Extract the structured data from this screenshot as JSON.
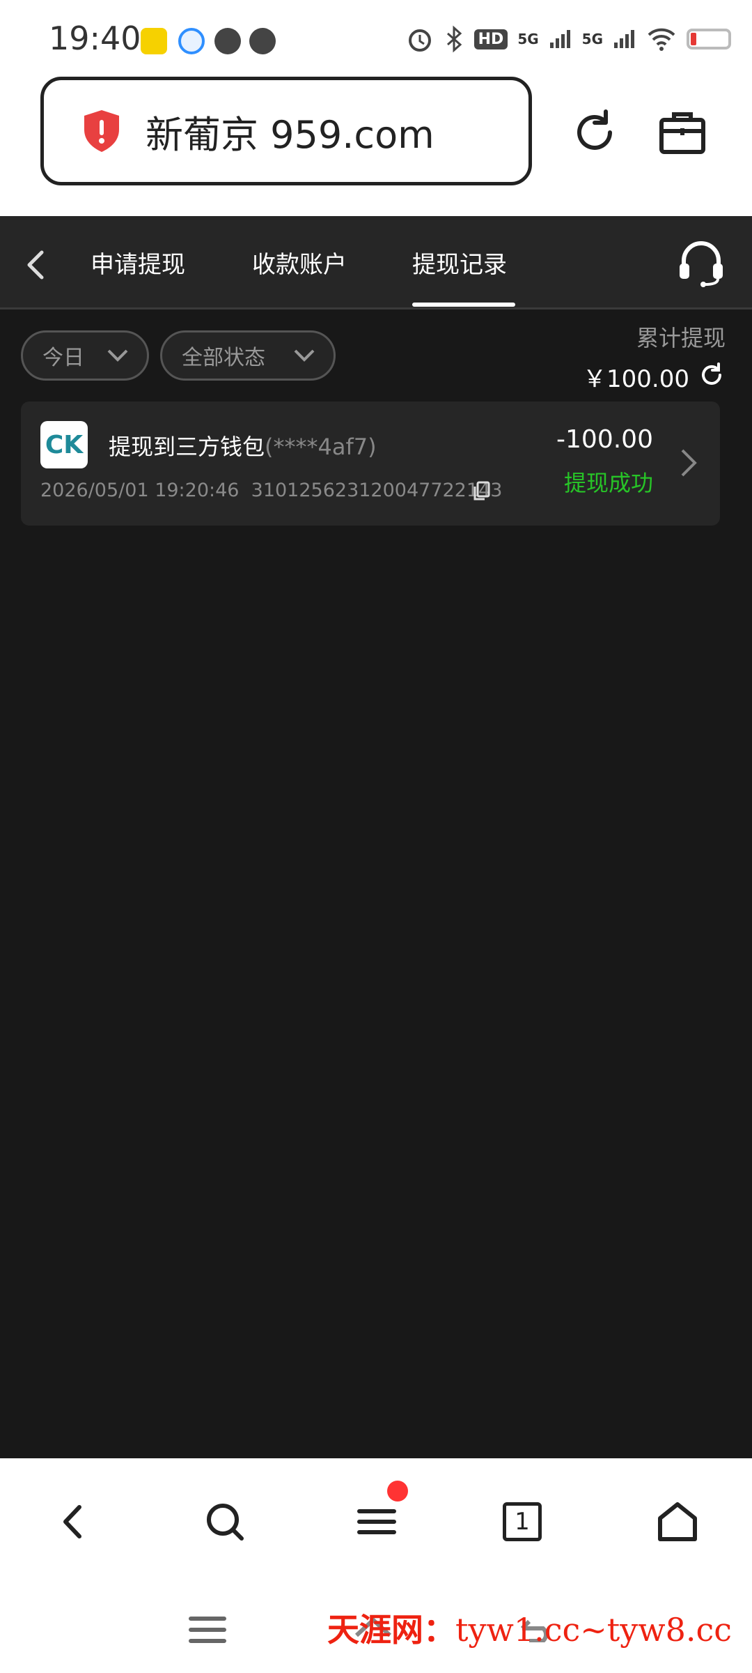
{
  "status_bar": {
    "time": "19:40",
    "network_labels": [
      "5G",
      "5G"
    ],
    "hd_label": "HD"
  },
  "browser": {
    "url": "新葡京 959.com",
    "icons": [
      "shield-alert-icon",
      "reload-icon",
      "briefcase-icon"
    ]
  },
  "tabs": {
    "items": [
      "申请提现",
      "收款账户",
      "提现记录"
    ],
    "active_index": 2
  },
  "filters": {
    "date": "今日",
    "status": "全部状态"
  },
  "summary": {
    "label": "累计提现",
    "amount": "￥100.00"
  },
  "records": [
    {
      "logo_text": "CK",
      "title": "提现到三方钱包",
      "account_mask": "(****4af7)",
      "datetime": "2026/05/01 19:20:46",
      "order_id": "310125623120047722143",
      "amount": "-100.00",
      "status": "提现成功"
    }
  ],
  "bottom_bar": {
    "tab_count": "1"
  },
  "watermark": {
    "name": "天涯网：",
    "urls": "tyw1.cc~tyw8.cc"
  },
  "colors": {
    "accent_green": "#27c427",
    "alert_red": "#e84040",
    "dark_bg": "#181818"
  }
}
